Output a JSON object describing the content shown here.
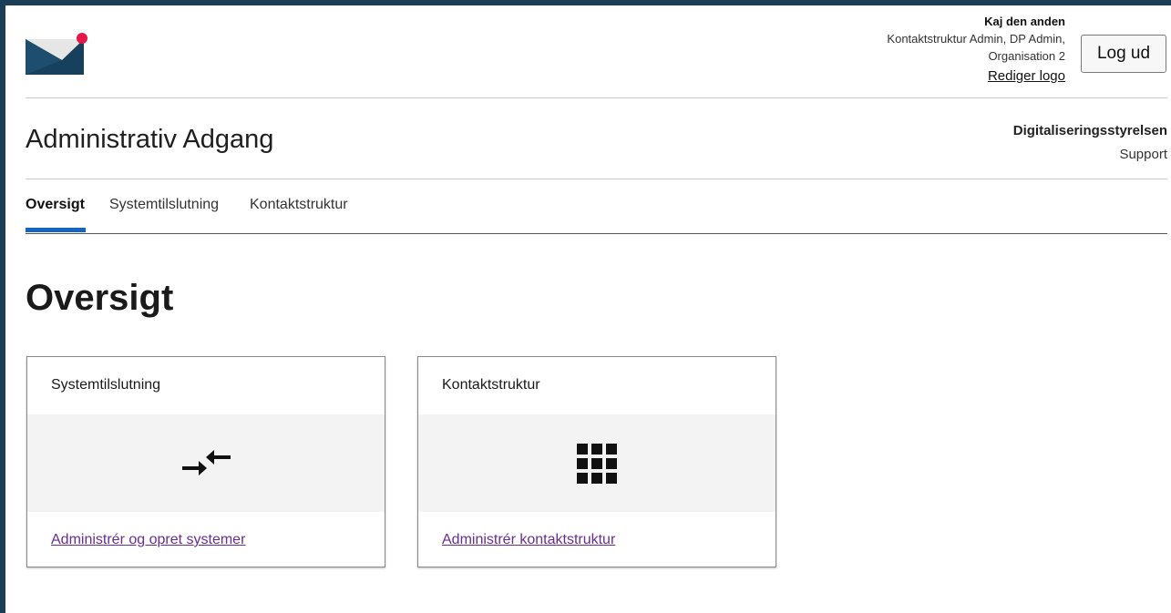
{
  "header": {
    "user_name": "Kaj den anden",
    "roles_line1": "Kontaktstruktur Admin, DP Admin,",
    "roles_line2": "Organisation 2",
    "edit_logo_label": "Rediger logo",
    "logout_label": "Log ud"
  },
  "app": {
    "title": "Administrativ Adgang",
    "organization": "Digitaliseringsstyrelsen",
    "support_label": "Support"
  },
  "tabs": [
    {
      "label": "Oversigt",
      "active": true
    },
    {
      "label": "Systemtilslutning",
      "active": false
    },
    {
      "label": "Kontaktstruktur",
      "active": false
    }
  ],
  "page": {
    "title": "Oversigt"
  },
  "cards": [
    {
      "title": "Systemtilslutning",
      "icon": "arrows-exchange-icon",
      "link_label": "Administrér og opret systemer"
    },
    {
      "title": "Kontaktstruktur",
      "icon": "grid-icon",
      "link_label": "Administrér kontaktstruktur"
    }
  ],
  "colors": {
    "frame": "#1b3d55",
    "accent": "#1565c0",
    "link": "#6b2c91",
    "logo_dark": "#16405c",
    "logo_light": "#e6e6e6",
    "logo_dot": "#e8174a"
  }
}
